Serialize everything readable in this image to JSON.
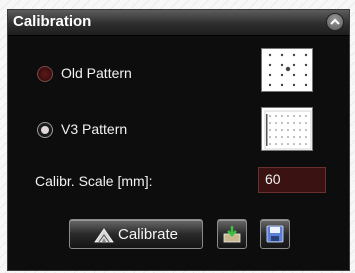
{
  "panel": {
    "title": "Calibration",
    "icons": {
      "collapse": "chevron-up-icon"
    }
  },
  "options": [
    {
      "label": "Old Pattern",
      "selected": false
    },
    {
      "label": "V3 Pattern",
      "selected": true
    }
  ],
  "scale": {
    "label": "Calibr. Scale [mm]:",
    "value": "60"
  },
  "buttons": {
    "calibrate": "Calibrate",
    "calibrate_icon": "calibrate-icon",
    "import_icon": "import-icon",
    "save_icon": "save-icon"
  },
  "colors": {
    "panel_bg": "#0d0d0d",
    "input_bg": "#3a1212",
    "radio_off": "#5e1a1a"
  }
}
